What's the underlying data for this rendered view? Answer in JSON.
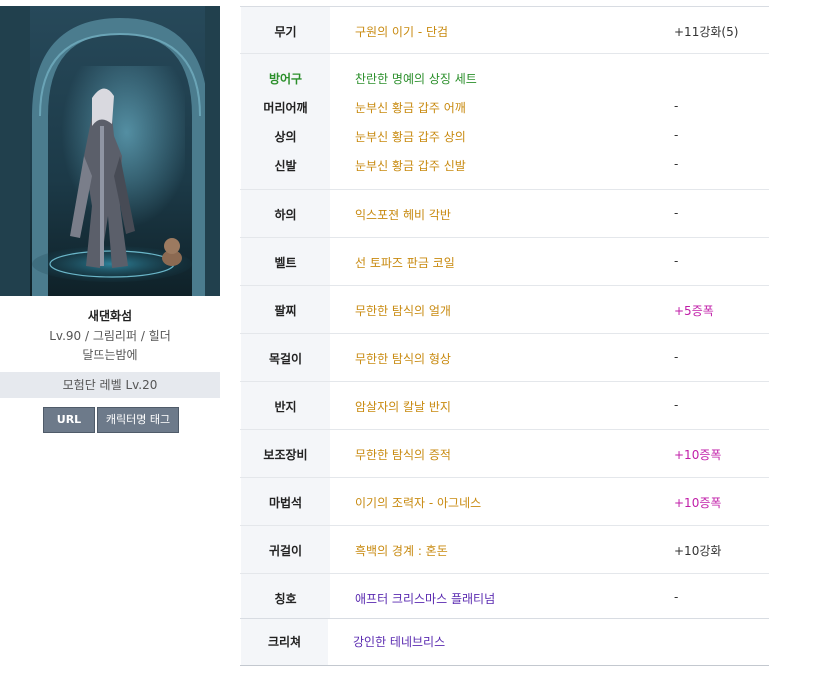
{
  "character": {
    "name": "새댄화섬",
    "info": "Lv.90 / 그림리퍼 / 힐더",
    "guild": "달뜨는밤에",
    "adventure_level": "모험단 레벨 Lv.20"
  },
  "buttons": {
    "url": "URL",
    "tag": "캐릭터명 태그"
  },
  "equipment": {
    "weapon": {
      "label": "무기",
      "item": "구원의 이기 - 단검",
      "extra": "+11강화(5)"
    },
    "armor_set": {
      "label": "방어구",
      "item": "찬란한 명예의 상징 세트"
    },
    "shoulder": {
      "label": "머리어깨",
      "item": "눈부신 황금 갑주 어깨",
      "extra": "-"
    },
    "top": {
      "label": "상의",
      "item": "눈부신 황금 갑주 상의",
      "extra": "-"
    },
    "shoes": {
      "label": "신발",
      "item": "눈부신 황금 갑주 신발",
      "extra": "-"
    },
    "bottom": {
      "label": "하의",
      "item": "익스포젼 헤비 각반",
      "extra": "-"
    },
    "belt": {
      "label": "벨트",
      "item": "선 토파즈 판금 코일",
      "extra": "-"
    },
    "bracelet": {
      "label": "팔찌",
      "item": "무한한 탐식의 얼개",
      "extra": "+5증폭"
    },
    "necklace": {
      "label": "목걸이",
      "item": "무한한 탐식의 형상",
      "extra": "-"
    },
    "ring": {
      "label": "반지",
      "item": "암살자의 칼날 반지",
      "extra": "-"
    },
    "support": {
      "label": "보조장비",
      "item": "무한한 탐식의 증적",
      "extra": "+10증폭"
    },
    "magic_stone": {
      "label": "마법석",
      "item": "이기의 조력자 - 아그네스",
      "extra": "+10증폭"
    },
    "earring": {
      "label": "귀걸이",
      "item": "흑백의 경계 : 혼돈",
      "extra": "+10강화"
    },
    "title": {
      "label": "칭호",
      "item": "애프터 크리스마스 플래티넘",
      "extra": "-"
    }
  },
  "creature": {
    "label": "크리쳐",
    "item": "강인한 테네브리스"
  },
  "colors": {
    "epic_gold": "#c88a10",
    "set_green": "#2b8f2b",
    "rare_purple": "#5a2ab0",
    "amplify_magenta": "#c01ea8"
  }
}
